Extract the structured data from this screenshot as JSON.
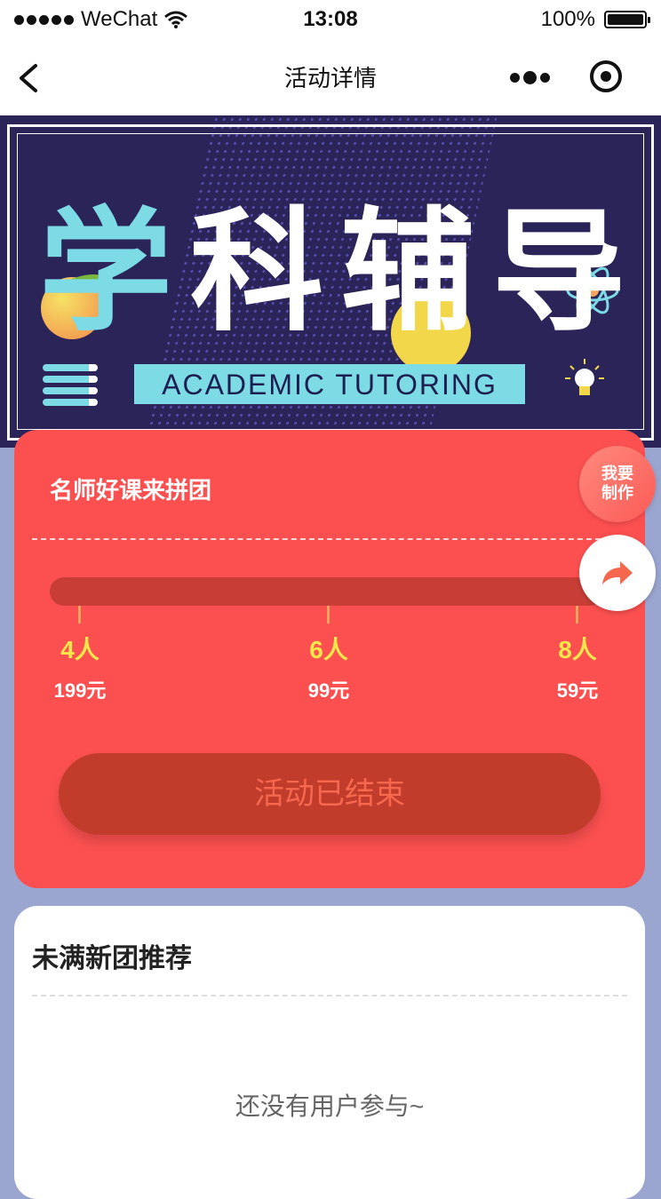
{
  "status_bar": {
    "carrier": "WeChat",
    "time": "13:08",
    "battery": "100%"
  },
  "nav": {
    "title": "活动详情"
  },
  "banner": {
    "headline_chars": [
      "学",
      "科",
      "辅",
      "导"
    ],
    "tagline": "ACADEMIC TUTORING"
  },
  "group_card": {
    "title": "名师好课来拼团",
    "tiers": [
      {
        "people": "4人",
        "price": "199元"
      },
      {
        "people": "6人",
        "price": "99元"
      },
      {
        "people": "8人",
        "price": "59元"
      }
    ],
    "button_label": "活动已结束"
  },
  "fab": {
    "make_line1": "我要",
    "make_line2": "制作"
  },
  "recommend": {
    "title": "未满新团推荐",
    "empty_text": "还没有用户参与~"
  },
  "colors": {
    "card_red": "#fc5050",
    "banner_navy": "#2a2459",
    "accent_cyan": "#7ddbe6",
    "tier_yellow": "#f8e74a"
  }
}
